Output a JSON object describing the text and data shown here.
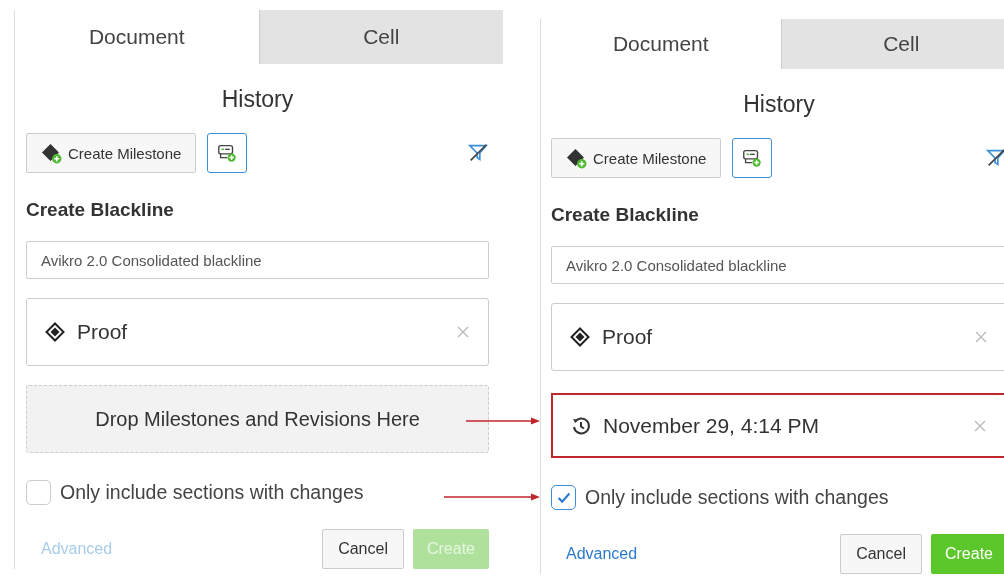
{
  "panels": [
    {
      "tabs": [
        {
          "label": "Document",
          "selected": true
        },
        {
          "label": "Cell",
          "selected": false
        }
      ],
      "heading": "History",
      "create_milestone": "Create Milestone",
      "section_title": "Create Blackline",
      "name_value": "Avikro 2.0 Consolidated blackline",
      "slots": [
        {
          "kind": "milestone",
          "label": "Proof"
        },
        {
          "kind": "dropzone",
          "label": "Drop Milestones and Revisions Here"
        }
      ],
      "checkbox": {
        "label": "Only include sections with changes",
        "checked": false
      },
      "advanced": {
        "label": "Advanced",
        "disabled": true
      },
      "cancel": "Cancel",
      "create": {
        "label": "Create",
        "disabled": true
      }
    },
    {
      "tabs": [
        {
          "label": "Document",
          "selected": true
        },
        {
          "label": "Cell",
          "selected": false
        }
      ],
      "heading": "History",
      "create_milestone": "Create Milestone",
      "section_title": "Create Blackline",
      "name_value": "Avikro 2.0 Consolidated blackline",
      "slots": [
        {
          "kind": "milestone",
          "label": "Proof"
        },
        {
          "kind": "revision",
          "label": "November 29, 4:14 PM",
          "highlighted": true
        }
      ],
      "checkbox": {
        "label": "Only include sections with changes",
        "checked": true
      },
      "advanced": {
        "label": "Advanced",
        "disabled": false
      },
      "cancel": "Cancel",
      "create": {
        "label": "Create",
        "disabled": false
      }
    }
  ]
}
